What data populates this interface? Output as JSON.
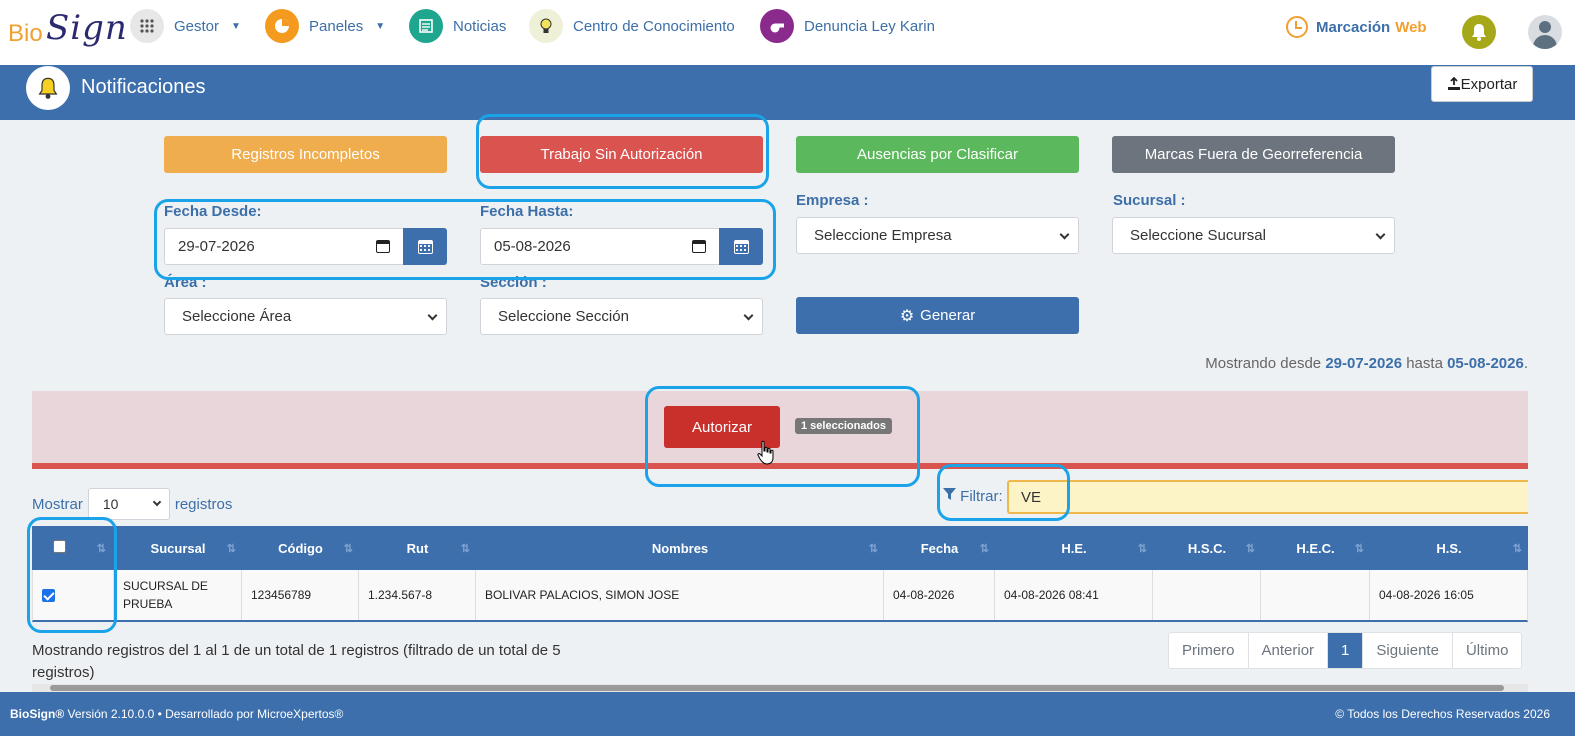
{
  "brand": {
    "logo_left": "Bio",
    "logo_right": "Sign"
  },
  "nav": {
    "gestor": "Gestor",
    "paneles": "Paneles",
    "noticias": "Noticias",
    "centro": "Centro de Conocimiento",
    "denuncia": "Denuncia Ley Karin",
    "marcacion": "Marcación",
    "web": "Web"
  },
  "header": {
    "title": "Notificaciones",
    "export_label": "Exportar"
  },
  "tabs": {
    "incompletos": "Registros Incompletos",
    "sin_autorizacion": "Trabajo Sin Autorización",
    "ausencias": "Ausencias por Clasificar",
    "georef": "Marcas Fuera de Georreferencia"
  },
  "colors": {
    "primary": "#3d6fad",
    "warning": "#f0ad4e",
    "danger": "#d9534f",
    "success": "#5cb85c",
    "secondary": "#6c757d",
    "highlight": "#1aa3e8"
  },
  "filters": {
    "fecha_desde_label": "Fecha Desde:",
    "fecha_desde": "29-07-2026",
    "fecha_hasta_label": "Fecha Hasta:",
    "fecha_hasta": "05-08-2026",
    "empresa_label": "Empresa :",
    "empresa": "Seleccione Empresa",
    "sucursal_label": "Sucursal :",
    "sucursal": "Seleccione Sucursal",
    "area_label": "Área :",
    "area": "Seleccione Área",
    "seccion_label": "Sección :",
    "seccion": "Seleccione Sección",
    "generar": "Generar"
  },
  "range": {
    "prefix": "Mostrando desde",
    "from": "29-07-2026",
    "mid": "hasta",
    "to": "05-08-2026",
    "suffix": "."
  },
  "actions": {
    "autorizar": "Autorizar",
    "selected_badge": "1 seleccionados"
  },
  "table_controls": {
    "mostrar": "Mostrar",
    "page_size": "10",
    "registros": "registros",
    "filtrar": "Filtrar:",
    "filter_value": "VE"
  },
  "table": {
    "headers": [
      "Sucursal",
      "Código",
      "Rut",
      "Nombres",
      "Fecha",
      "H.E.",
      "H.S.C.",
      "H.E.C.",
      "H.S."
    ],
    "rows": [
      {
        "checked": true,
        "sucursal": "SUCURSAL DE PRUEBA",
        "codigo": "123456789",
        "rut": "1.234.567-8",
        "nombres": "BOLIVAR PALACIOS, SIMON JOSE",
        "fecha": "04-08-2026",
        "he": "04-08-2026 08:41",
        "hsc": "",
        "hec": "",
        "hs": "04-08-2026 16:05"
      }
    ]
  },
  "info_text": "Mostrando registros del 1 al 1 de un total de 1 registros (filtrado de un total de 5 registros)",
  "pager": {
    "first": "Primero",
    "prev": "Anterior",
    "current": "1",
    "next": "Siguiente",
    "last": "Último"
  },
  "footer": {
    "brand": "BioSign®",
    "version": "Versión 2.10.0.0 • Desarrollado por",
    "company": "MicroeXpertos®",
    "rights": "© Todos los Derechos Reservados 2026"
  }
}
